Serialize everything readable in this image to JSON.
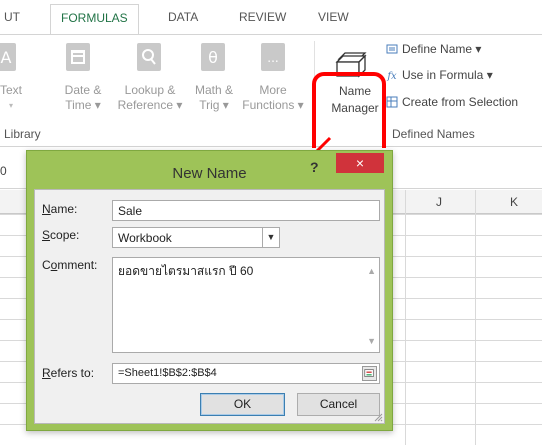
{
  "tabs": [
    {
      "label": "UT",
      "active": false
    },
    {
      "label": "FORMULAS",
      "active": true
    },
    {
      "label": "DATA",
      "active": false
    },
    {
      "label": "REVIEW",
      "active": false
    },
    {
      "label": "VIEW",
      "active": false
    }
  ],
  "ribbon": {
    "library_buttons": [
      {
        "line1": "Text",
        "line2": "▾",
        "icon": "text-function-icon"
      },
      {
        "line1": "Date &",
        "line2": "Time ▾",
        "icon": "calendar-icon"
      },
      {
        "line1": "Lookup &",
        "line2": "Reference ▾",
        "icon": "lookup-icon"
      },
      {
        "line1": "Math &",
        "line2": "Trig ▾",
        "icon": "theta-icon"
      },
      {
        "line1": "More",
        "line2": "Functions ▾",
        "icon": "more-functions-icon"
      }
    ],
    "library_label": "Library",
    "name_manager": {
      "line1": "Name",
      "line2": "Manager"
    },
    "defined_names": [
      {
        "label": "Define Name ▾",
        "icon": "define-name-icon"
      },
      {
        "label": "Use in Formula ▾",
        "icon": "use-in-formula-icon"
      },
      {
        "label": "Create from Selection",
        "icon": "create-from-selection-icon"
      }
    ],
    "defined_names_label": "Defined Names"
  },
  "formula_bar": {
    "partial_text": "0"
  },
  "columns": [
    "J",
    "K"
  ],
  "dialog": {
    "title": "New Name",
    "help": "?",
    "close": "×",
    "name_label": "Name:",
    "name_value": "Sale",
    "scope_label": "Scope:",
    "scope_value": "Workbook",
    "comment_label": "Comment:",
    "comment_value": "ยอดขายไตรมาสแรก ปี 60",
    "refers_label": "Refers to:",
    "refers_value": "=Sheet1!$B$2:$B$4",
    "ok": "OK",
    "cancel": "Cancel"
  },
  "colors": {
    "accent": "#217346",
    "highlight": "#ff0000",
    "dialog_frame": "#9ec358",
    "close": "#d0333b"
  }
}
